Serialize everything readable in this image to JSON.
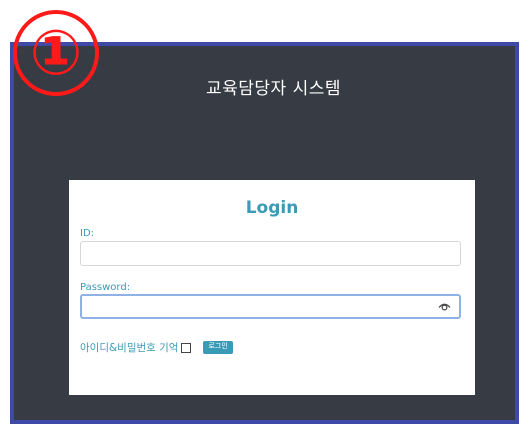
{
  "badge": {
    "label": "①",
    "color": "#ff1a1a"
  },
  "header": {
    "title": "교육담당자 시스템"
  },
  "login": {
    "title": "Login",
    "id_label": "ID:",
    "id_value": "",
    "password_label": "Password:",
    "password_value": "",
    "remember_label": "아이디&비밀번호 기억",
    "remember_checked": false,
    "submit_label": "로그인"
  },
  "icons": {
    "password_toggle": "eye-icon"
  },
  "colors": {
    "frame_bg": "#363b44",
    "frame_border": "#3f4aa8",
    "accent": "#3a9bb6"
  }
}
